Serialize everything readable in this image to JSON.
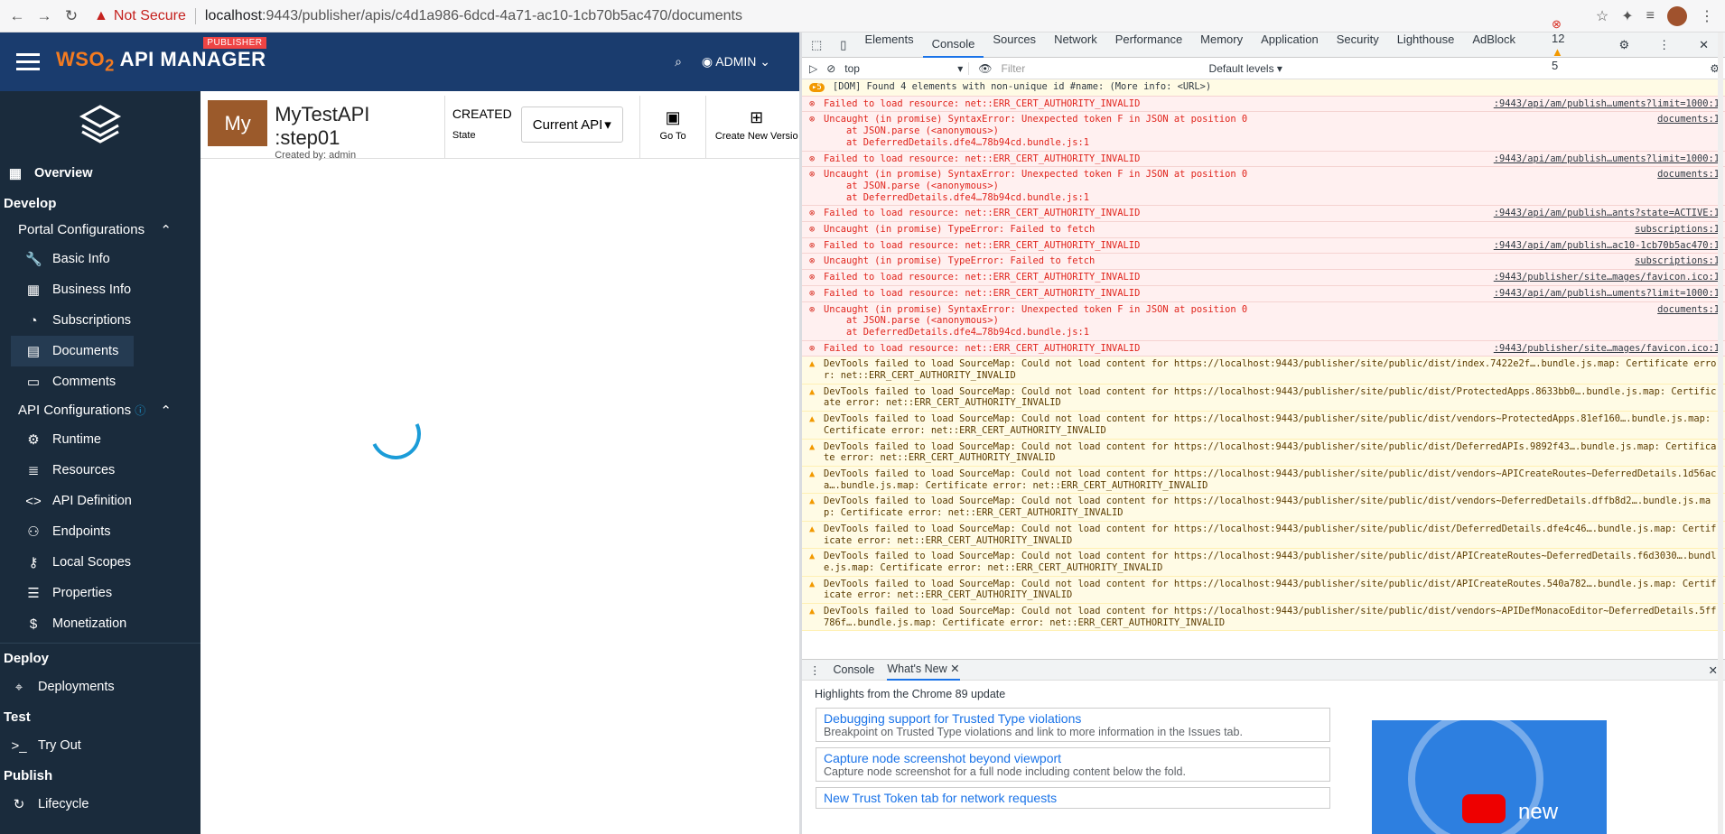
{
  "browser": {
    "not_secure": "Not Secure",
    "url_host": "localhost",
    "url_rest": ":9443/publisher/apis/c4d1a986-6dcd-4a71-ac10-1cb70b5ac470/documents"
  },
  "header": {
    "brand_wso": "WSO",
    "brand_two": "2",
    "brand_name": "API MANAGER",
    "publisher_badge": "PUBLISHER",
    "user": "ADMIN"
  },
  "sidebar": {
    "overview": "Overview",
    "develop": "Develop",
    "portal_configurations": "Portal Configurations",
    "portal_items": [
      {
        "icon": "wrench-icon",
        "glyph": "🔧",
        "label": "Basic Info"
      },
      {
        "icon": "business-icon",
        "glyph": "▦",
        "label": "Business Info"
      },
      {
        "icon": "rss-icon",
        "glyph": "◔",
        "label": "Subscriptions"
      },
      {
        "icon": "documents-icon",
        "glyph": "▤",
        "label": "Documents"
      },
      {
        "icon": "comments-icon",
        "glyph": "▭",
        "label": "Comments"
      }
    ],
    "api_configurations": "API Configurations",
    "api_items": [
      {
        "icon": "gear-icon",
        "glyph": "⚙",
        "label": "Runtime"
      },
      {
        "icon": "resources-icon",
        "glyph": "≣",
        "label": "Resources"
      },
      {
        "icon": "code-icon",
        "glyph": "<>",
        "label": "API Definition"
      },
      {
        "icon": "endpoints-icon",
        "glyph": "⚇",
        "label": "Endpoints"
      },
      {
        "icon": "key-icon",
        "glyph": "⚷",
        "label": "Local Scopes"
      },
      {
        "icon": "list-icon",
        "glyph": "☰",
        "label": "Properties"
      },
      {
        "icon": "dollar-icon",
        "glyph": "$",
        "label": "Monetization"
      }
    ],
    "deploy": "Deploy",
    "deployments": "Deployments",
    "test": "Test",
    "try_out": "Try Out",
    "publish": "Publish",
    "lifecycle": "Lifecycle"
  },
  "api": {
    "thumb": "My",
    "name": "MyTestAPI :step01",
    "created_by": "Created by: admin",
    "state_value": "CREATED",
    "state_label": "State",
    "version_select": "Current API",
    "go_to": "Go To",
    "create_new_version": "Create New Versio"
  },
  "devtools": {
    "tabs": [
      "Elements",
      "Console",
      "Sources",
      "Network",
      "Performance",
      "Memory",
      "Application",
      "Security",
      "Lighthouse",
      "AdBlock"
    ],
    "error_count": "12",
    "warning_count": "5",
    "context": "top",
    "filter_placeholder": "Filter",
    "levels": "Default levels",
    "info_badge": "5",
    "info_line": "[DOM] Found 4 elements with non-unique id #name: (More info: <URL>)",
    "lines": [
      {
        "type": "error",
        "text": "Failed to load resource: net::ERR_CERT_AUTHORITY_INVALID",
        "src": ":9443/api/am/publish…uments?limit=1000:1"
      },
      {
        "type": "error",
        "text": "Uncaught (in promise) SyntaxError: Unexpected token F in JSON at position 0\n    at JSON.parse (<anonymous>)\n    at DeferredDetails.dfe4…78b94cd.bundle.js:1",
        "src": "documents:1"
      },
      {
        "type": "error",
        "text": "Failed to load resource: net::ERR_CERT_AUTHORITY_INVALID",
        "src": ":9443/api/am/publish…uments?limit=1000:1"
      },
      {
        "type": "error",
        "text": "Uncaught (in promise) SyntaxError: Unexpected token F in JSON at position 0\n    at JSON.parse (<anonymous>)\n    at DeferredDetails.dfe4…78b94cd.bundle.js:1",
        "src": "documents:1"
      },
      {
        "type": "error",
        "text": "Failed to load resource: net::ERR_CERT_AUTHORITY_INVALID",
        "src": ":9443/api/am/publish…ants?state=ACTIVE:1"
      },
      {
        "type": "error",
        "text": "Uncaught (in promise) TypeError: Failed to fetch",
        "src": "subscriptions:1"
      },
      {
        "type": "error",
        "text": "Failed to load resource: net::ERR_CERT_AUTHORITY_INVALID",
        "src": ":9443/api/am/publish…ac10-1cb70b5ac470:1"
      },
      {
        "type": "error",
        "text": "Uncaught (in promise) TypeError: Failed to fetch",
        "src": "subscriptions:1"
      },
      {
        "type": "error",
        "text": "Failed to load resource: net::ERR_CERT_AUTHORITY_INVALID",
        "src": ":9443/publisher/site…mages/favicon.ico:1"
      },
      {
        "type": "error",
        "text": "Failed to load resource: net::ERR_CERT_AUTHORITY_INVALID",
        "src": ":9443/api/am/publish…uments?limit=1000:1"
      },
      {
        "type": "error",
        "text": "Uncaught (in promise) SyntaxError: Unexpected token F in JSON at position 0\n    at JSON.parse (<anonymous>)\n    at DeferredDetails.dfe4…78b94cd.bundle.js:1",
        "src": "documents:1"
      },
      {
        "type": "error",
        "text": "Failed to load resource: net::ERR_CERT_AUTHORITY_INVALID",
        "src": ":9443/publisher/site…mages/favicon.ico:1"
      },
      {
        "type": "warning",
        "text": "DevTools failed to load SourceMap: Could not load content for https://localhost:9443/publisher/site/public/dist/index.7422e2f….bundle.js.map: Certificate error: net::ERR_CERT_AUTHORITY_INVALID",
        "src": ""
      },
      {
        "type": "warning",
        "text": "DevTools failed to load SourceMap: Could not load content for https://localhost:9443/publisher/site/public/dist/ProtectedApps.8633bb0….bundle.js.map: Certificate error: net::ERR_CERT_AUTHORITY_INVALID",
        "src": ""
      },
      {
        "type": "warning",
        "text": "DevTools failed to load SourceMap: Could not load content for https://localhost:9443/publisher/site/public/dist/vendors~ProtectedApps.81ef160….bundle.js.map: Certificate error: net::ERR_CERT_AUTHORITY_INVALID",
        "src": ""
      },
      {
        "type": "warning",
        "text": "DevTools failed to load SourceMap: Could not load content for https://localhost:9443/publisher/site/public/dist/DeferredAPIs.9892f43….bundle.js.map: Certificate error: net::ERR_CERT_AUTHORITY_INVALID",
        "src": ""
      },
      {
        "type": "warning",
        "text": "DevTools failed to load SourceMap: Could not load content for https://localhost:9443/publisher/site/public/dist/vendors~APICreateRoutes~DeferredDetails.1d56aca….bundle.js.map: Certificate error: net::ERR_CERT_AUTHORITY_INVALID",
        "src": ""
      },
      {
        "type": "warning",
        "text": "DevTools failed to load SourceMap: Could not load content for https://localhost:9443/publisher/site/public/dist/vendors~DeferredDetails.dffb8d2….bundle.js.map: Certificate error: net::ERR_CERT_AUTHORITY_INVALID",
        "src": ""
      },
      {
        "type": "warning",
        "text": "DevTools failed to load SourceMap: Could not load content for https://localhost:9443/publisher/site/public/dist/DeferredDetails.dfe4c46….bundle.js.map: Certificate error: net::ERR_CERT_AUTHORITY_INVALID",
        "src": ""
      },
      {
        "type": "warning",
        "text": "DevTools failed to load SourceMap: Could not load content for https://localhost:9443/publisher/site/public/dist/APICreateRoutes~DeferredDetails.f6d3030….bundle.js.map: Certificate error: net::ERR_CERT_AUTHORITY_INVALID",
        "src": ""
      },
      {
        "type": "warning",
        "text": "DevTools failed to load SourceMap: Could not load content for https://localhost:9443/publisher/site/public/dist/APICreateRoutes.540a782….bundle.js.map: Certificate error: net::ERR_CERT_AUTHORITY_INVALID",
        "src": ""
      },
      {
        "type": "warning",
        "text": "DevTools failed to load SourceMap: Could not load content for https://localhost:9443/publisher/site/public/dist/vendors~APIDefMonacoEditor~DeferredDetails.5ff786f….bundle.js.map: Certificate error: net::ERR_CERT_AUTHORITY_INVALID",
        "src": ""
      }
    ],
    "drawer_tabs": {
      "console": "Console",
      "whats_new": "What's New"
    },
    "highlights": "Highlights from the Chrome 89 update",
    "cards": [
      {
        "title": "Debugging support for Trusted Type violations",
        "desc": "Breakpoint on Trusted Type violations and link to more information in the Issues tab."
      },
      {
        "title": "Capture node screenshot beyond viewport",
        "desc": "Capture node screenshot for a full node including content below the fold."
      },
      {
        "title": "New Trust Token tab for network requests",
        "desc": ""
      }
    ],
    "promo_new": "new"
  }
}
